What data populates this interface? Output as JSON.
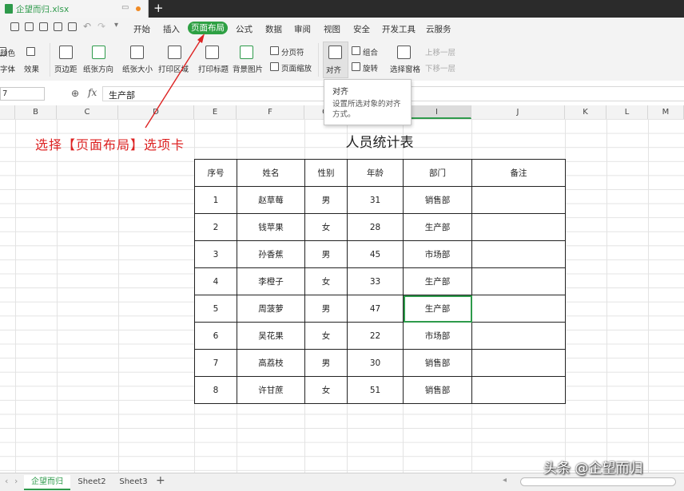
{
  "file": {
    "name": "企望而归.xlsx"
  },
  "menu": {
    "items": [
      "开始",
      "插入",
      "页面布局",
      "公式",
      "数据",
      "审阅",
      "视图",
      "安全",
      "开发工具",
      "云服务"
    ],
    "active": "页面布局"
  },
  "ribbon": {
    "left_labels": [
      "颜色",
      "字体",
      "效果"
    ],
    "buttons": [
      "页边距",
      "纸张方向",
      "纸张大小",
      "打印区域",
      "打印标题",
      "背景图片"
    ],
    "small": [
      "分页符",
      "页面缩放",
      "组合",
      "旋转",
      "上移一层",
      "下移一层"
    ],
    "align": "对齐",
    "pane": "选择窗格"
  },
  "tooltip": {
    "title": "对齐",
    "desc": "设置所选对象的对齐方式。"
  },
  "formula": {
    "namebox": "7",
    "fx": "fx",
    "value": "生产部"
  },
  "columns": [
    "B",
    "C",
    "D",
    "E",
    "F",
    "G",
    "H",
    "I",
    "J",
    "K",
    "L",
    "M"
  ],
  "annotation": "选择【页面布局】选项卡",
  "table": {
    "title": "人员统计表",
    "headers": [
      "序号",
      "姓名",
      "性别",
      "年龄",
      "部门",
      "备注"
    ],
    "rows": [
      [
        "1",
        "赵草莓",
        "男",
        "31",
        "销售部",
        ""
      ],
      [
        "2",
        "钱苹果",
        "女",
        "28",
        "生产部",
        ""
      ],
      [
        "3",
        "孙香蕉",
        "男",
        "45",
        "市场部",
        ""
      ],
      [
        "4",
        "李橙子",
        "女",
        "33",
        "生产部",
        ""
      ],
      [
        "5",
        "周菠萝",
        "男",
        "47",
        "生产部",
        ""
      ],
      [
        "6",
        "吴花果",
        "女",
        "22",
        "市场部",
        ""
      ],
      [
        "7",
        "高荔枝",
        "男",
        "30",
        "销售部",
        ""
      ],
      [
        "8",
        "许甘蔗",
        "女",
        "51",
        "销售部",
        ""
      ]
    ]
  },
  "sheets": [
    "企望而归",
    "Sheet2",
    "Sheet3"
  ],
  "watermark": "头条 @企望而归",
  "colors": {
    "accent": "#2ea043",
    "annotation": "#dd2222"
  }
}
